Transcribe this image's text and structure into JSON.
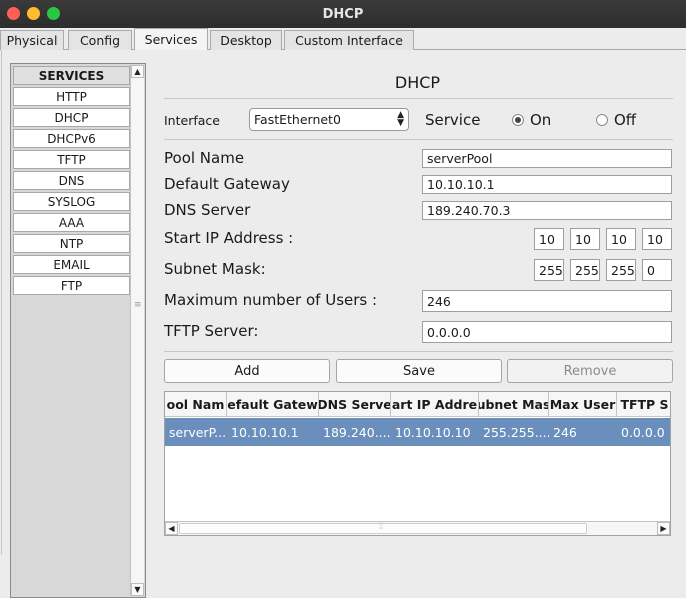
{
  "window": {
    "title": "DHCP"
  },
  "tabs": [
    {
      "label": "Physical"
    },
    {
      "label": "Config"
    },
    {
      "label": "Services"
    },
    {
      "label": "Desktop"
    },
    {
      "label": "Custom Interface"
    }
  ],
  "services": {
    "header": "SERVICES",
    "items": [
      "HTTP",
      "DHCP",
      "DHCPv6",
      "TFTP",
      "DNS",
      "SYSLOG",
      "AAA",
      "NTP",
      "EMAIL",
      "FTP"
    ]
  },
  "dhcp": {
    "title": "DHCP",
    "interface_label": "Interface",
    "interface_value": "FastEthernet0",
    "service_label": "Service",
    "on_label": "On",
    "off_label": "Off",
    "service_state": "On",
    "pool_name_label": "Pool Name",
    "pool_name_value": "serverPool",
    "gateway_label": "Default Gateway",
    "gateway_value": "10.10.10.1",
    "dns_label": "DNS Server",
    "dns_value": "189.240.70.3",
    "start_ip_label": "Start IP Address :",
    "start_ip": [
      "10",
      "10",
      "10",
      "10"
    ],
    "mask_label": "Subnet Mask:",
    "mask": [
      "255",
      "255",
      "255",
      "0"
    ],
    "max_users_label": "Maximum number of Users :",
    "max_users_value": "246",
    "tftp_label": "TFTP Server:",
    "tftp_value": "0.0.0.0"
  },
  "buttons": {
    "add": "Add",
    "save": "Save",
    "remove": "Remove"
  },
  "table": {
    "headers": [
      "ool Nam",
      "efault Gatew",
      "DNS Serve",
      "art IP Addre",
      "ubnet Mas",
      "Max User",
      "TFTP S"
    ],
    "rows": [
      [
        "serverP...",
        "10.10.10.1",
        "189.240....",
        "10.10.10.10",
        "255.255....",
        "246",
        "0.0.0.0"
      ]
    ]
  },
  "colors": {
    "selection": "#6a8fbd",
    "titlebar": "#2d2d2d"
  }
}
